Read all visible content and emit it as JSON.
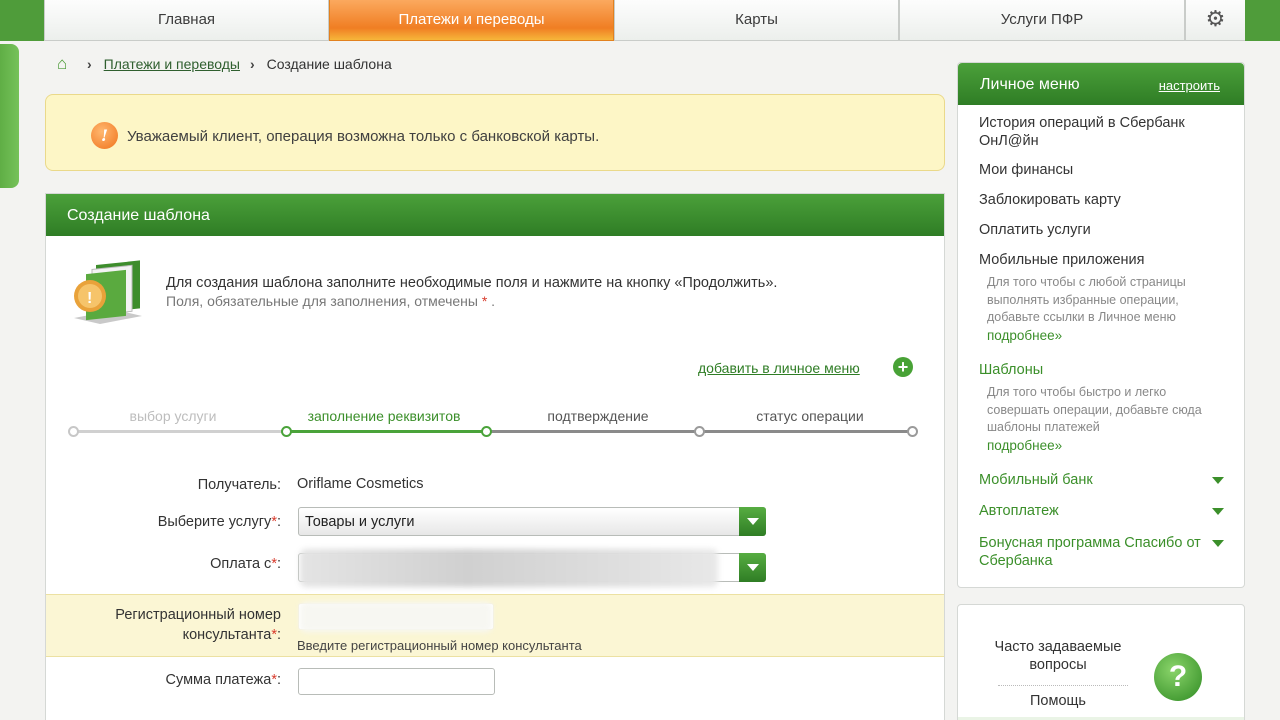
{
  "nav": {
    "tabs": [
      {
        "label": "Главная",
        "active": false
      },
      {
        "label": "Платежи и переводы",
        "active": true
      },
      {
        "label": "Карты",
        "active": false
      },
      {
        "label": "Услуги ПФР",
        "active": false
      }
    ],
    "settings_icon": "gear-icon"
  },
  "breadcrumb": {
    "home_icon": "home-icon",
    "link": "Платежи и переводы",
    "current": "Создание шаблона"
  },
  "warning": {
    "icon": "exclamation-icon",
    "text": "Уважаемый клиент, операция возможна только с банковской карты."
  },
  "main": {
    "title": "Создание шаблона",
    "intro_line1": "Для создания шаблона заполните необходимые поля и нажмите на кнопку «Продолжить».",
    "intro_line2": "Поля, обязательные для заполнения, отмечены",
    "intro_star": "*",
    "intro_dot": ".",
    "add_to_menu": "добавить в личное меню",
    "steps": [
      "выбор услуги",
      "заполнение реквизитов",
      "подтверждение",
      "статус операции"
    ],
    "active_step": 2,
    "form": {
      "recipient_label": "Получатель:",
      "recipient_value": "Oriflame Cosmetics",
      "service_label": "Выберите услугу",
      "service_value": "Товары и услуги",
      "payfrom_label": "Оплата с",
      "consultant_label_1": "Регистрационный номер",
      "consultant_label_2": "консультанта",
      "consultant_hint": "Введите регистрационный номер консультанта",
      "amount_label": "Сумма платежа",
      "required_mark": "*",
      "colon": ":"
    }
  },
  "sidebar": {
    "title": "Личное меню",
    "configure": "настроить",
    "items": [
      {
        "label": "История операций в Сбербанк ОнЛ@йн"
      },
      {
        "label": "Мои финансы"
      },
      {
        "label": "Заблокировать карту"
      },
      {
        "label": "Оплатить услуги"
      },
      {
        "label": "Мобильные приложения"
      }
    ],
    "mobile_desc": "Для того чтобы с любой страницы выполнять избранные операции, добавьте ссылки в Личное меню",
    "more": "подробнее»",
    "templates_label": "Шаблоны",
    "templates_desc": "Для того чтобы быстро и легко совершать операции, добавьте сюда шаблоны платежей",
    "expandables": [
      "Мобильный банк",
      "Автоплатеж",
      "Бонусная программа Спасибо от Сбербанка"
    ]
  },
  "faq": {
    "title": "Часто задаваемые вопросы",
    "help": "Помощь",
    "icon": "question-icon"
  },
  "colors": {
    "brand_green": "#2f7d25",
    "active_tab_orange": "#f07e23",
    "warning_bg": "#fdf6c6"
  }
}
